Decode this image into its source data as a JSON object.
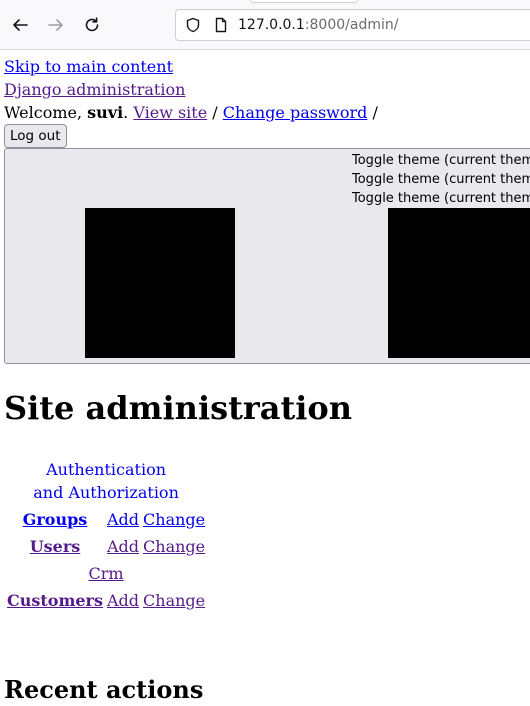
{
  "browser": {
    "url_host": "127.0.0.1",
    "url_rest": ":8000/admin/",
    "icons": [
      "back-arrow-icon",
      "forward-arrow-icon",
      "reload-icon",
      "shield-icon",
      "page-icon"
    ]
  },
  "header": {
    "skip_link": "Skip to main content",
    "branding": "Django administration",
    "welcome_prefix": "Welcome, ",
    "username": "suvi",
    "welcome_suffix": ". ",
    "view_site": "View site",
    "separator": " / ",
    "change_password": "Change password",
    "trailing_separator": " /",
    "logout": "Log out"
  },
  "theme_toggle": {
    "label": "Toggle theme (current theme: auto)"
  },
  "main": {
    "title": "Site administration",
    "apps": [
      {
        "name": "Authentication and Authorization",
        "models": [
          {
            "name": "Groups",
            "add": "Add",
            "change": "Change"
          },
          {
            "name": "Users",
            "add": "Add",
            "change": "Change"
          }
        ]
      },
      {
        "name": "Crm",
        "models": [
          {
            "name": "Customers",
            "add": "Add",
            "change": "Change"
          }
        ]
      }
    ],
    "recent_actions": "Recent actions"
  }
}
